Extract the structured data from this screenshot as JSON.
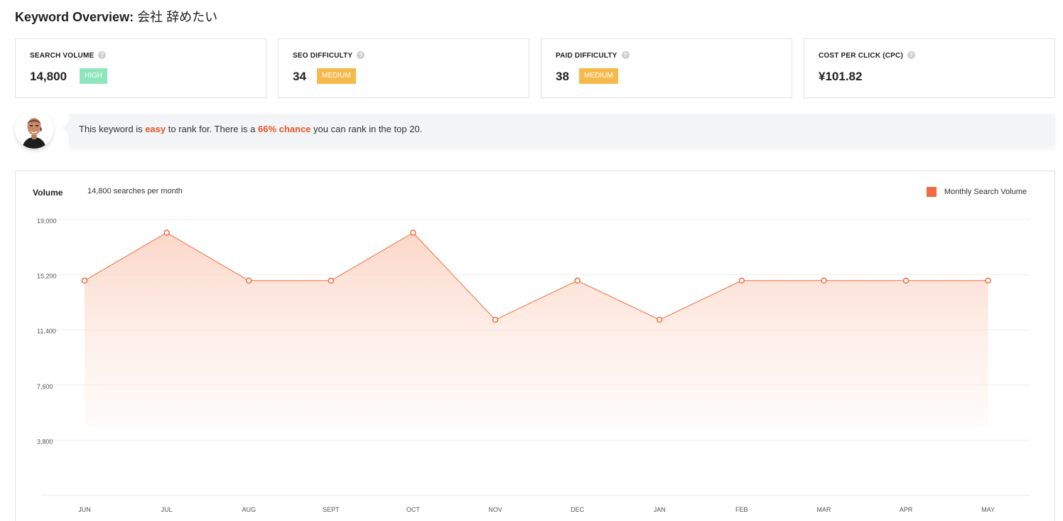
{
  "header": {
    "title_label": "Keyword Overview:",
    "keyword": "会社 辞めたい"
  },
  "metrics": [
    {
      "label": "SEARCH VOLUME",
      "value": "14,800",
      "badge": "HIGH"
    },
    {
      "label": "SEO DIFFICULTY",
      "value": "34",
      "badge": "MEDIUM"
    },
    {
      "label": "PAID DIFFICULTY",
      "value": "38",
      "badge": "MEDIUM"
    },
    {
      "label": "COST PER CLICK (CPC)",
      "value": "¥101.82"
    }
  ],
  "help_icon_glyph": "?",
  "tip": {
    "t1": "This keyword is",
    "h1": "easy",
    "t2": "to rank for. There is a",
    "h2": "66% chance",
    "t3": "you can rank in the top 20."
  },
  "colors": {
    "accent": "#f26a3d",
    "highlight_text": "#e3572e",
    "badge_high": "#8ee6bd",
    "badge_medium": "#f6b94c"
  },
  "chart": {
    "title": "Volume",
    "subtitle": "14,800 searches per month",
    "legend_label": "Monthly Search Volume"
  },
  "chart_data": {
    "type": "area",
    "categories": [
      "JUN",
      "JUL",
      "AUG",
      "SEPT",
      "OCT",
      "NOV",
      "DEC",
      "JAN",
      "FEB",
      "MAR",
      "APR",
      "MAY"
    ],
    "series": [
      {
        "name": "Monthly Search Volume",
        "values": [
          14800,
          18100,
          14800,
          14800,
          18100,
          12100,
          14800,
          12100,
          14800,
          14800,
          14800,
          14800
        ]
      }
    ],
    "ylim": [
      0,
      19000
    ],
    "yticks": [
      3800,
      7600,
      11400,
      15200,
      19000
    ],
    "ytick_labels": [
      "3,800",
      "7,600",
      "11,400",
      "15,200",
      "19,000"
    ],
    "grid": true,
    "legend": "top-right"
  }
}
